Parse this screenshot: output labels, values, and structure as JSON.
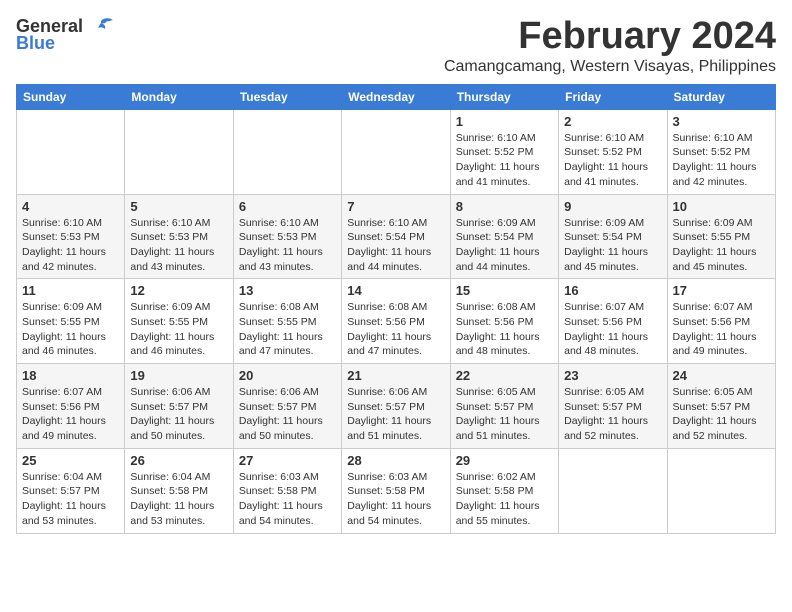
{
  "logo": {
    "general": "General",
    "blue": "Blue"
  },
  "title": "February 2024",
  "subtitle": "Camangcamang, Western Visayas, Philippines",
  "headers": [
    "Sunday",
    "Monday",
    "Tuesday",
    "Wednesday",
    "Thursday",
    "Friday",
    "Saturday"
  ],
  "weeks": [
    [
      {
        "day": "",
        "detail": ""
      },
      {
        "day": "",
        "detail": ""
      },
      {
        "day": "",
        "detail": ""
      },
      {
        "day": "",
        "detail": ""
      },
      {
        "day": "1",
        "detail": "Sunrise: 6:10 AM\nSunset: 5:52 PM\nDaylight: 11 hours and 41 minutes."
      },
      {
        "day": "2",
        "detail": "Sunrise: 6:10 AM\nSunset: 5:52 PM\nDaylight: 11 hours and 41 minutes."
      },
      {
        "day": "3",
        "detail": "Sunrise: 6:10 AM\nSunset: 5:52 PM\nDaylight: 11 hours and 42 minutes."
      }
    ],
    [
      {
        "day": "4",
        "detail": "Sunrise: 6:10 AM\nSunset: 5:53 PM\nDaylight: 11 hours and 42 minutes."
      },
      {
        "day": "5",
        "detail": "Sunrise: 6:10 AM\nSunset: 5:53 PM\nDaylight: 11 hours and 43 minutes."
      },
      {
        "day": "6",
        "detail": "Sunrise: 6:10 AM\nSunset: 5:53 PM\nDaylight: 11 hours and 43 minutes."
      },
      {
        "day": "7",
        "detail": "Sunrise: 6:10 AM\nSunset: 5:54 PM\nDaylight: 11 hours and 44 minutes."
      },
      {
        "day": "8",
        "detail": "Sunrise: 6:09 AM\nSunset: 5:54 PM\nDaylight: 11 hours and 44 minutes."
      },
      {
        "day": "9",
        "detail": "Sunrise: 6:09 AM\nSunset: 5:54 PM\nDaylight: 11 hours and 45 minutes."
      },
      {
        "day": "10",
        "detail": "Sunrise: 6:09 AM\nSunset: 5:55 PM\nDaylight: 11 hours and 45 minutes."
      }
    ],
    [
      {
        "day": "11",
        "detail": "Sunrise: 6:09 AM\nSunset: 5:55 PM\nDaylight: 11 hours and 46 minutes."
      },
      {
        "day": "12",
        "detail": "Sunrise: 6:09 AM\nSunset: 5:55 PM\nDaylight: 11 hours and 46 minutes."
      },
      {
        "day": "13",
        "detail": "Sunrise: 6:08 AM\nSunset: 5:55 PM\nDaylight: 11 hours and 47 minutes."
      },
      {
        "day": "14",
        "detail": "Sunrise: 6:08 AM\nSunset: 5:56 PM\nDaylight: 11 hours and 47 minutes."
      },
      {
        "day": "15",
        "detail": "Sunrise: 6:08 AM\nSunset: 5:56 PM\nDaylight: 11 hours and 48 minutes."
      },
      {
        "day": "16",
        "detail": "Sunrise: 6:07 AM\nSunset: 5:56 PM\nDaylight: 11 hours and 48 minutes."
      },
      {
        "day": "17",
        "detail": "Sunrise: 6:07 AM\nSunset: 5:56 PM\nDaylight: 11 hours and 49 minutes."
      }
    ],
    [
      {
        "day": "18",
        "detail": "Sunrise: 6:07 AM\nSunset: 5:56 PM\nDaylight: 11 hours and 49 minutes."
      },
      {
        "day": "19",
        "detail": "Sunrise: 6:06 AM\nSunset: 5:57 PM\nDaylight: 11 hours and 50 minutes."
      },
      {
        "day": "20",
        "detail": "Sunrise: 6:06 AM\nSunset: 5:57 PM\nDaylight: 11 hours and 50 minutes."
      },
      {
        "day": "21",
        "detail": "Sunrise: 6:06 AM\nSunset: 5:57 PM\nDaylight: 11 hours and 51 minutes."
      },
      {
        "day": "22",
        "detail": "Sunrise: 6:05 AM\nSunset: 5:57 PM\nDaylight: 11 hours and 51 minutes."
      },
      {
        "day": "23",
        "detail": "Sunrise: 6:05 AM\nSunset: 5:57 PM\nDaylight: 11 hours and 52 minutes."
      },
      {
        "day": "24",
        "detail": "Sunrise: 6:05 AM\nSunset: 5:57 PM\nDaylight: 11 hours and 52 minutes."
      }
    ],
    [
      {
        "day": "25",
        "detail": "Sunrise: 6:04 AM\nSunset: 5:57 PM\nDaylight: 11 hours and 53 minutes."
      },
      {
        "day": "26",
        "detail": "Sunrise: 6:04 AM\nSunset: 5:58 PM\nDaylight: 11 hours and 53 minutes."
      },
      {
        "day": "27",
        "detail": "Sunrise: 6:03 AM\nSunset: 5:58 PM\nDaylight: 11 hours and 54 minutes."
      },
      {
        "day": "28",
        "detail": "Sunrise: 6:03 AM\nSunset: 5:58 PM\nDaylight: 11 hours and 54 minutes."
      },
      {
        "day": "29",
        "detail": "Sunrise: 6:02 AM\nSunset: 5:58 PM\nDaylight: 11 hours and 55 minutes."
      },
      {
        "day": "",
        "detail": ""
      },
      {
        "day": "",
        "detail": ""
      }
    ]
  ]
}
